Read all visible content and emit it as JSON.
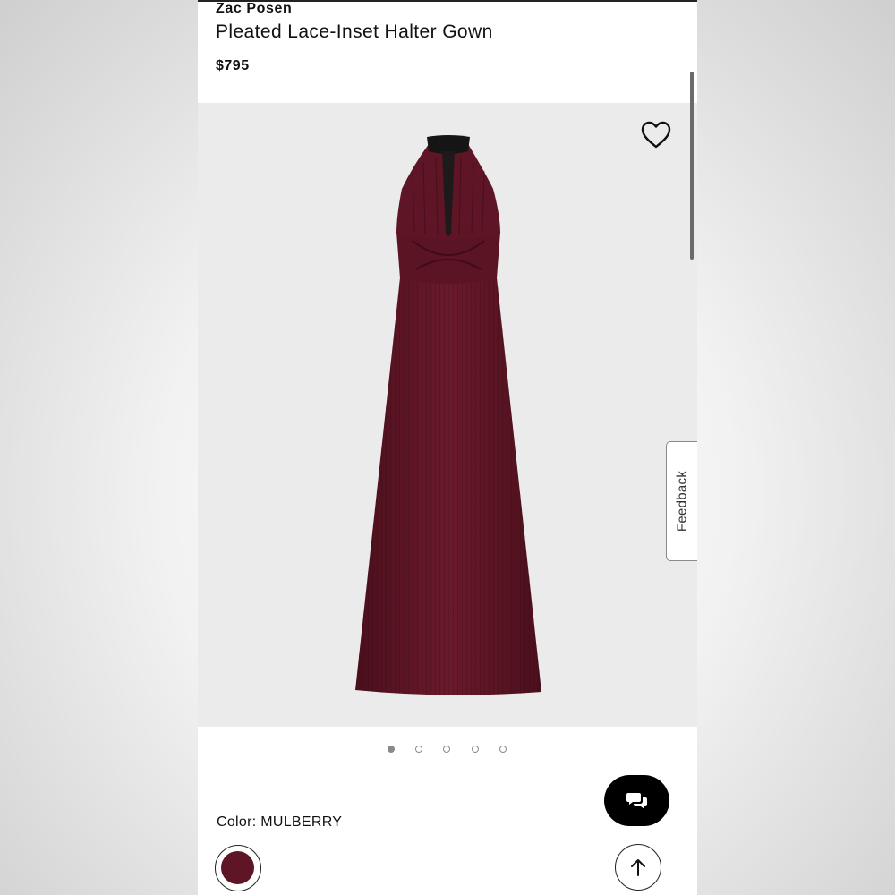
{
  "product": {
    "brand": "Zac Posen",
    "title": "Pleated Lace-Inset Halter Gown",
    "price": "$795"
  },
  "gallery": {
    "total_images": 5,
    "active_index": 0,
    "favorite_icon": "heart-icon"
  },
  "feedback_tab": {
    "label": "Feedback"
  },
  "color": {
    "label": "Color:",
    "value": "MULBERRY",
    "swatch_hex": "#5e1525"
  },
  "actions": {
    "chat_icon": "chat-bubbles-icon",
    "back_to_top_icon": "arrow-up-icon"
  },
  "colors": {
    "gown": "#5e1525",
    "gown_shadow": "#3e0b17",
    "lace": "#151515",
    "image_background": "#ebebeb"
  }
}
